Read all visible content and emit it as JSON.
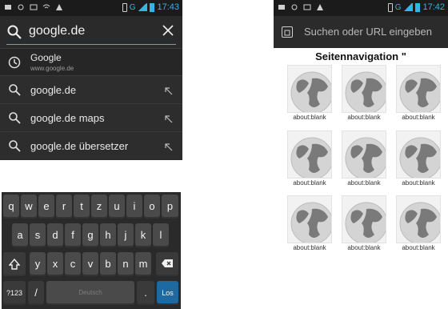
{
  "left_phone": {
    "status": {
      "time": "17:43",
      "network": "G"
    },
    "urlbar": {
      "query": "google.de"
    },
    "suggestions": [
      {
        "icon": "history-icon",
        "text": "Google",
        "subtext": "www.google.de"
      },
      {
        "icon": "search-icon",
        "text": "google.de"
      },
      {
        "icon": "search-icon",
        "text": "google.de maps"
      },
      {
        "icon": "search-icon",
        "text": "google.de übersetzer"
      }
    ],
    "keyboard": {
      "row1": [
        "q",
        "w",
        "e",
        "r",
        "t",
        "z",
        "u",
        "i",
        "o",
        "p"
      ],
      "row2": [
        "a",
        "s",
        "d",
        "f",
        "g",
        "h",
        "j",
        "k",
        "l"
      ],
      "row3": [
        "y",
        "x",
        "c",
        "v",
        "b",
        "n",
        "m"
      ],
      "symbols_key": "?123",
      "slash_key": "/",
      "space_label": "Deutsch",
      "period_key": ".",
      "go_key": "Los"
    }
  },
  "right_phone": {
    "status": {
      "time": "17:42",
      "network": "G"
    },
    "urlbar": {
      "placeholder": "Suchen oder URL eingeben"
    },
    "section_title": "Seitennavigation \"",
    "thumbnails": [
      "about:blank",
      "about:blank",
      "about:blank",
      "about:blank",
      "about:blank",
      "about:blank",
      "about:blank",
      "about:blank",
      "about:blank"
    ]
  },
  "colors": {
    "accent": "#33b5e5",
    "dark_bg": "#2b2b2b",
    "go_key": "#1e6aa0"
  }
}
